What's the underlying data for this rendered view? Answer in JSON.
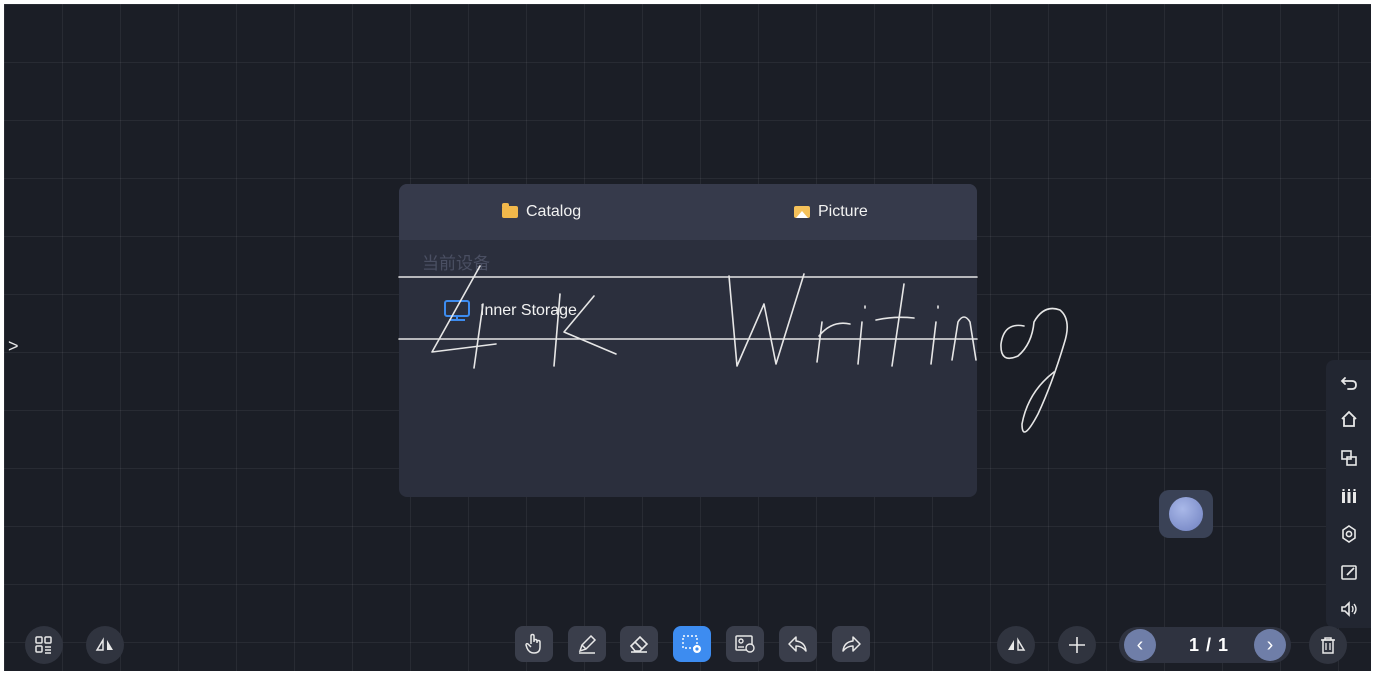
{
  "dialog": {
    "tabs": [
      {
        "label": "Catalog",
        "icon": "folder-icon"
      },
      {
        "label": "Picture",
        "icon": "picture-icon"
      }
    ],
    "section_title": "当前设备",
    "storage_items": [
      {
        "label": "Inner Storage",
        "icon": "monitor-icon"
      }
    ]
  },
  "handwriting": {
    "text": "4K Writing"
  },
  "left_toggle": {
    "glyph": ">"
  },
  "right_sidebar": {
    "items": [
      "undo-icon",
      "home-icon",
      "window-icon",
      "pens-icon",
      "settings-icon",
      "annotate-icon",
      "volume-icon"
    ]
  },
  "bottom_toolbar": {
    "left": [
      "apps-icon",
      "mirror-icon"
    ],
    "tools": [
      "hand-icon",
      "pen-icon",
      "eraser-icon",
      "select-icon",
      "image-icon",
      "undo-icon",
      "redo-icon"
    ],
    "active_tool": "select-icon",
    "pager": {
      "current": 1,
      "total": 1,
      "label": "1 / 1"
    },
    "right": [
      "mirror-icon",
      "add-page-icon",
      "delete-icon"
    ]
  },
  "colors": {
    "board": "#1b1e26",
    "accent": "#3d8cf0",
    "folder": "#f2b84b",
    "ink": "#e8e8e8"
  }
}
